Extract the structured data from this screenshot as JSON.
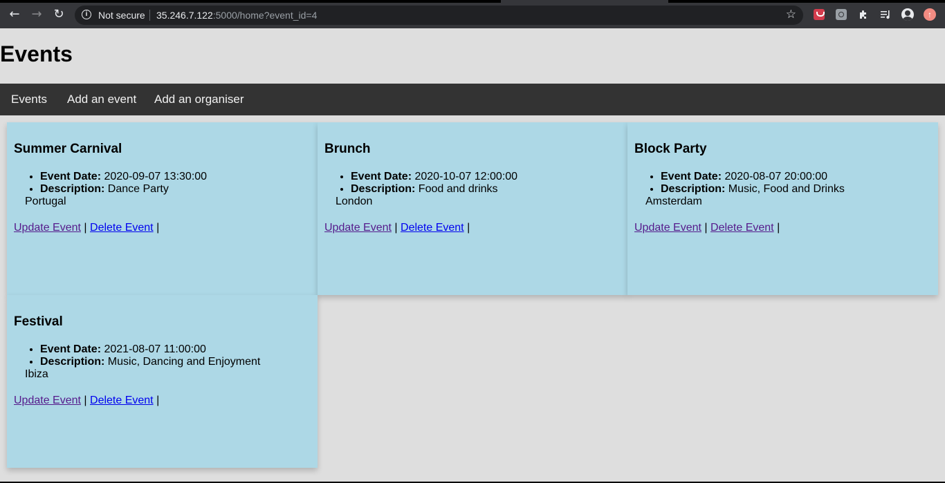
{
  "browser": {
    "security_text": "Not secure",
    "url_host": "35.246.7.122",
    "url_rest": ":5000/home?event_id=4",
    "icons": [
      "back-icon",
      "forward-icon",
      "reload-icon",
      "info-icon",
      "star-icon",
      "pocket-icon",
      "extension-square-icon",
      "puzzle-icon",
      "media-control-icon",
      "profile-icon",
      "update-icon"
    ]
  },
  "page": {
    "title": "Events"
  },
  "nav": {
    "items": [
      {
        "label": "Events"
      },
      {
        "label": "Add an event"
      },
      {
        "label": "Add an organiser"
      }
    ]
  },
  "labels": {
    "event_date": "Event Date:",
    "description": "Description:",
    "update": "Update Event",
    "delete": "Delete Event",
    "sep": "|"
  },
  "events": [
    {
      "name": "Summer Carnival",
      "date": "2020-09-07 13:30:00",
      "description": "Dance Party",
      "location": "Portugal"
    },
    {
      "name": "Brunch",
      "date": "2020-10-07 12:00:00",
      "description": "Food and drinks",
      "location": "London"
    },
    {
      "name": "Block Party",
      "date": "2020-08-07 20:00:00",
      "description": "Music, Food and Drinks",
      "location": "Amsterdam"
    },
    {
      "name": "Festival",
      "date": "2021-08-07 11:00:00",
      "description": "Music, Dancing and Enjoyment",
      "location": "Ibiza"
    }
  ],
  "colors": {
    "card_bg": "#add8e6",
    "nav_bg": "#333333",
    "page_bg": "#dedede"
  }
}
